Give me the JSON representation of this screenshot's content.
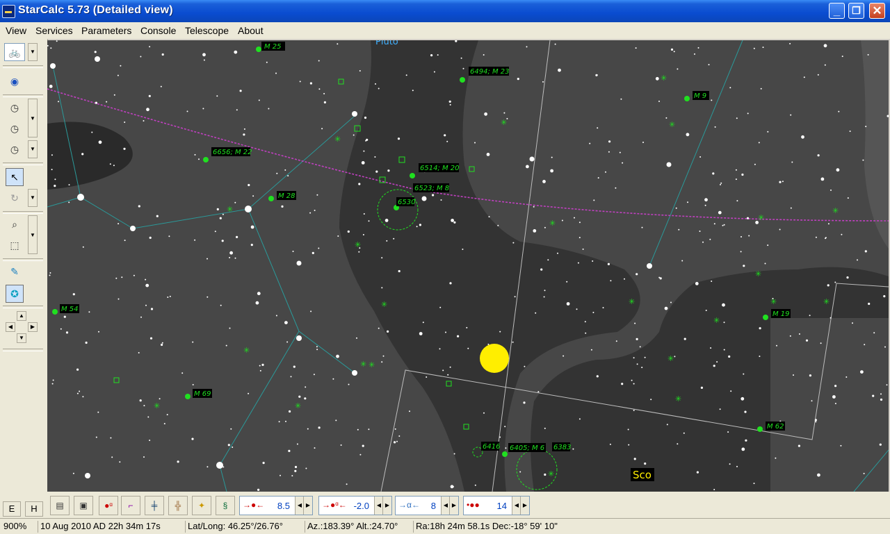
{
  "window": {
    "title": "StarCalc 5.73 (Detailed view)",
    "minimize": "_",
    "maximize": "❐",
    "close": "✕"
  },
  "menu": [
    "View",
    "Services",
    "Parameters",
    "Console",
    "Telescope",
    "About"
  ],
  "sidebar": {
    "e_label": "E",
    "h_label": "H"
  },
  "sky": {
    "labels": {
      "pluto": "Pluto",
      "m25": "M 25",
      "m23": "6494; M 23",
      "m9": "M 9",
      "m22": "6656; M 22",
      "m28": "M 28",
      "m20": "6514; M 20",
      "m8": "6523; M 8",
      "ngc6530": "6530",
      "m54": "M 54",
      "m19": "M 19",
      "m69": "M 69",
      "m62": "M 62",
      "ngc6416": "6416",
      "m6": "6405; M 6",
      "ngc6383": "6383",
      "sco": "Sco"
    },
    "colors": {
      "sky": "#333333",
      "milky_way": "#474747",
      "milky_way_light": "#555555",
      "constellation_lines": "#2a9a9a",
      "ecliptic": "#c040c0",
      "deep_sky": "#20e020",
      "boundary": "#bdbdbd",
      "sun": "#ffee00"
    }
  },
  "bottombar": {
    "mag_limit": "8.5",
    "offset": "-2.0",
    "ds_limit": "8",
    "size": "14"
  },
  "status": {
    "zoom": "900%",
    "datetime": "10 Aug 2010 AD 22h 34m 17s",
    "latlong": "Lat/Long: 46.25°/26.76°",
    "azalt": "Az.:183.39° Alt.:24.70°",
    "radec": "Ra:18h 24m 58.1s Dec:-18° 59' 10\""
  }
}
